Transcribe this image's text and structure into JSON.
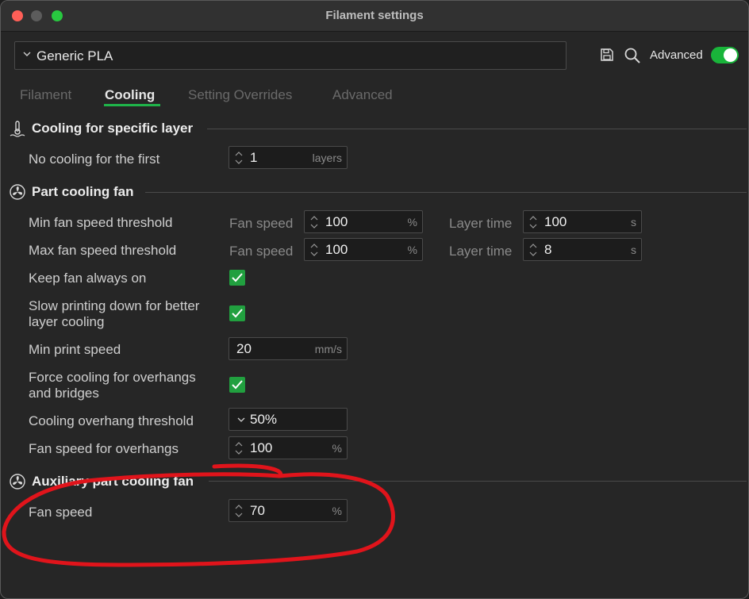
{
  "window": {
    "title": "Filament settings"
  },
  "preset": {
    "value": "Generic PLA"
  },
  "header": {
    "advanced_label": "Advanced",
    "advanced_on": true
  },
  "tabs": [
    {
      "label": "Filament",
      "active": false
    },
    {
      "label": "Cooling",
      "active": true
    },
    {
      "label": "Setting Overrides",
      "active": false
    },
    {
      "label": "Advanced",
      "active": false
    }
  ],
  "sections": {
    "cooling_layer": {
      "title": "Cooling for specific layer",
      "no_cooling": {
        "label": "No cooling for the first",
        "value": "1",
        "unit": "layers"
      }
    },
    "part_fan": {
      "title": "Part cooling fan",
      "min_fan": {
        "label": "Min fan speed threshold",
        "fan_label": "Fan speed",
        "fan_value": "100",
        "fan_unit": "%",
        "layer_label": "Layer time",
        "layer_value": "100",
        "layer_unit": "s"
      },
      "max_fan": {
        "label": "Max fan speed threshold",
        "fan_label": "Fan speed",
        "fan_value": "100",
        "fan_unit": "%",
        "layer_label": "Layer time",
        "layer_value": "8",
        "layer_unit": "s"
      },
      "keep_fan": {
        "label": "Keep fan always on",
        "checked": true
      },
      "slow_down": {
        "label_line1": "Slow printing down for better",
        "label_line2": "layer cooling",
        "checked": true
      },
      "min_print_speed": {
        "label": "Min print speed",
        "value": "20",
        "unit": "mm/s"
      },
      "force_cooling": {
        "label_line1": "Force cooling for overhangs",
        "label_line2": "and bridges",
        "checked": true
      },
      "overhang_threshold": {
        "label": "Cooling overhang threshold",
        "value": "50%"
      },
      "overhang_fan": {
        "label": "Fan speed for overhangs",
        "value": "100",
        "unit": "%"
      }
    },
    "aux_fan": {
      "title": "Auxiliary part cooling fan",
      "fan_speed": {
        "label": "Fan speed",
        "value": "70",
        "unit": "%"
      }
    }
  },
  "colors": {
    "accent": "#1fb44a",
    "annotation": "#e0141b"
  }
}
